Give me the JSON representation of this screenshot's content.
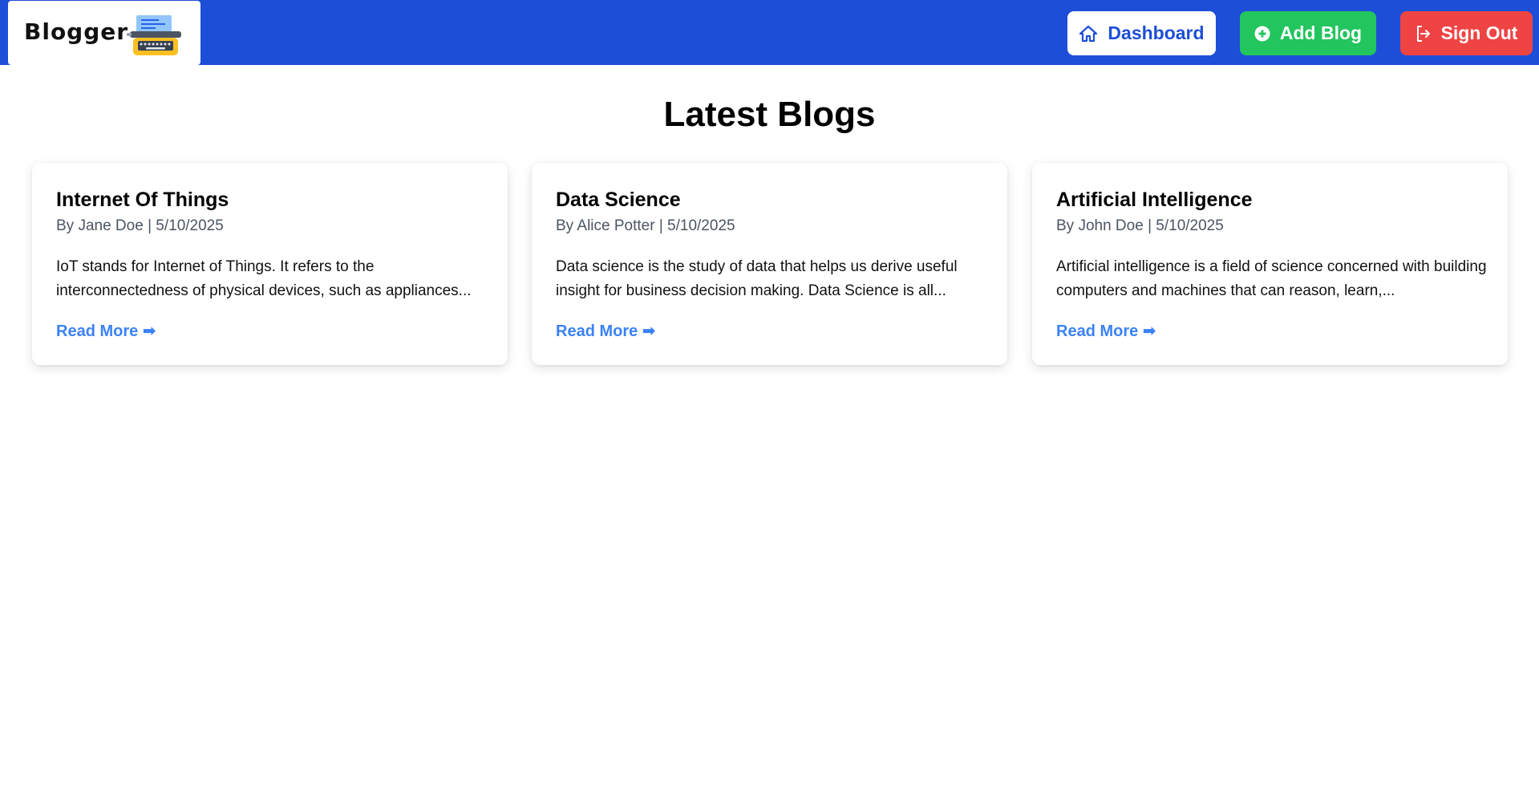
{
  "app": {
    "logo_text": "Blogger",
    "logo_icon": "typewriter-icon"
  },
  "nav": {
    "dashboard_label": "Dashboard",
    "dashboard_icon": "home-icon",
    "add_blog_label": "Add Blog",
    "add_blog_icon": "plus-circle-icon",
    "sign_out_label": "Sign Out",
    "sign_out_icon": "sign-out-icon"
  },
  "colors": {
    "navbar": "#1d4ed8",
    "add_button": "#22c55e",
    "sign_out_button": "#ef4444",
    "link": "#3b82f6"
  },
  "page": {
    "title": "Latest Blogs"
  },
  "blogs": [
    {
      "title": "Internet Of Things",
      "meta": "By Jane Doe | 5/10/2025",
      "excerpt": "IoT stands for Internet of Things. It refers to the interconnectedness of physical devices, such as appliances...",
      "link_label": "Read More ➡"
    },
    {
      "title": "Data Science",
      "meta": "By Alice Potter | 5/10/2025",
      "excerpt": "Data science is the study of data that helps us derive useful insight for business decision making. Data Science is all...",
      "link_label": "Read More ➡"
    },
    {
      "title": "Artificial Intelligence",
      "meta": "By John Doe | 5/10/2025",
      "excerpt": "Artificial intelligence is a field of science concerned with building computers and machines that can reason, learn,...",
      "link_label": "Read More ➡"
    }
  ]
}
